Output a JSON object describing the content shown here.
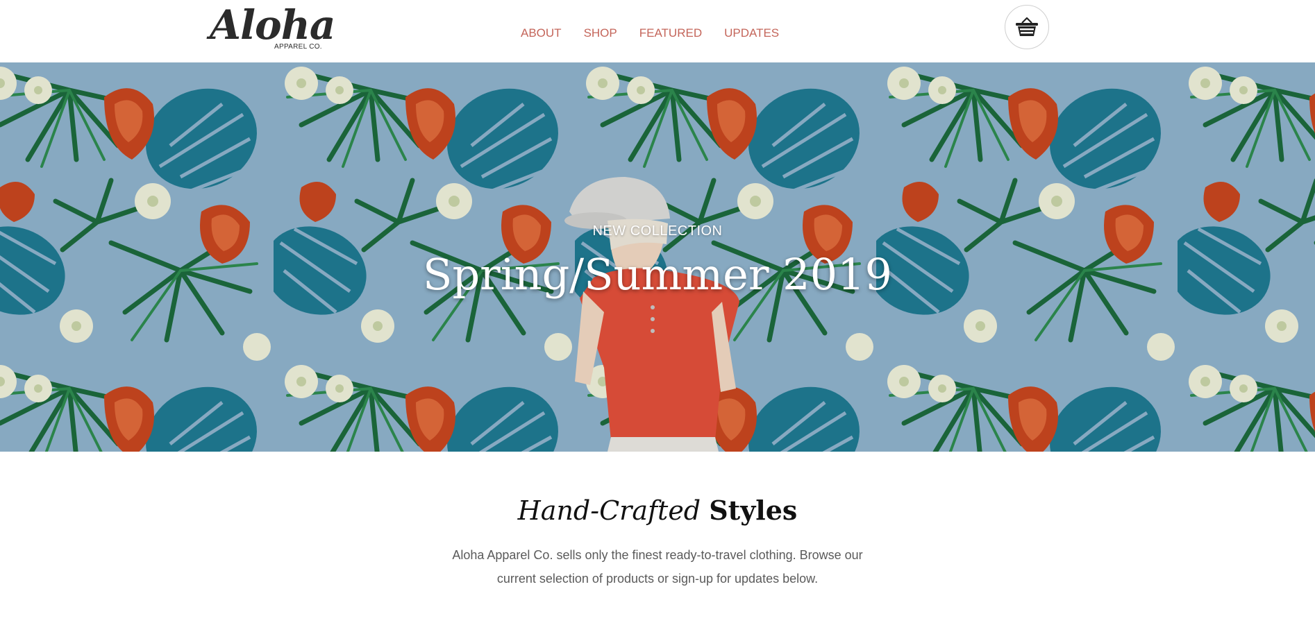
{
  "header": {
    "logo": {
      "script": "Aloha",
      "subtitle": "APPAREL CO."
    },
    "nav": [
      {
        "label": "ABOUT"
      },
      {
        "label": "SHOP"
      },
      {
        "label": "FEATURED"
      },
      {
        "label": "UPDATES"
      }
    ],
    "cart_icon": "basket-icon"
  },
  "hero": {
    "kicker": "NEW COLLECTION",
    "title": "Spring/Summer 2019",
    "background": "tropical-floral-pattern"
  },
  "intro": {
    "heading_em": "Hand-Crafted",
    "heading_strong": "Styles",
    "text": "Aloha Apparel Co. sells only the finest ready-to-travel clothing. Browse our current selection of products or sign-up for updates below."
  },
  "colors": {
    "nav_link": "#c4655a",
    "hero_bg": "#8fb3cc",
    "text_dark": "#111111",
    "text_muted": "#5a5a5a"
  }
}
